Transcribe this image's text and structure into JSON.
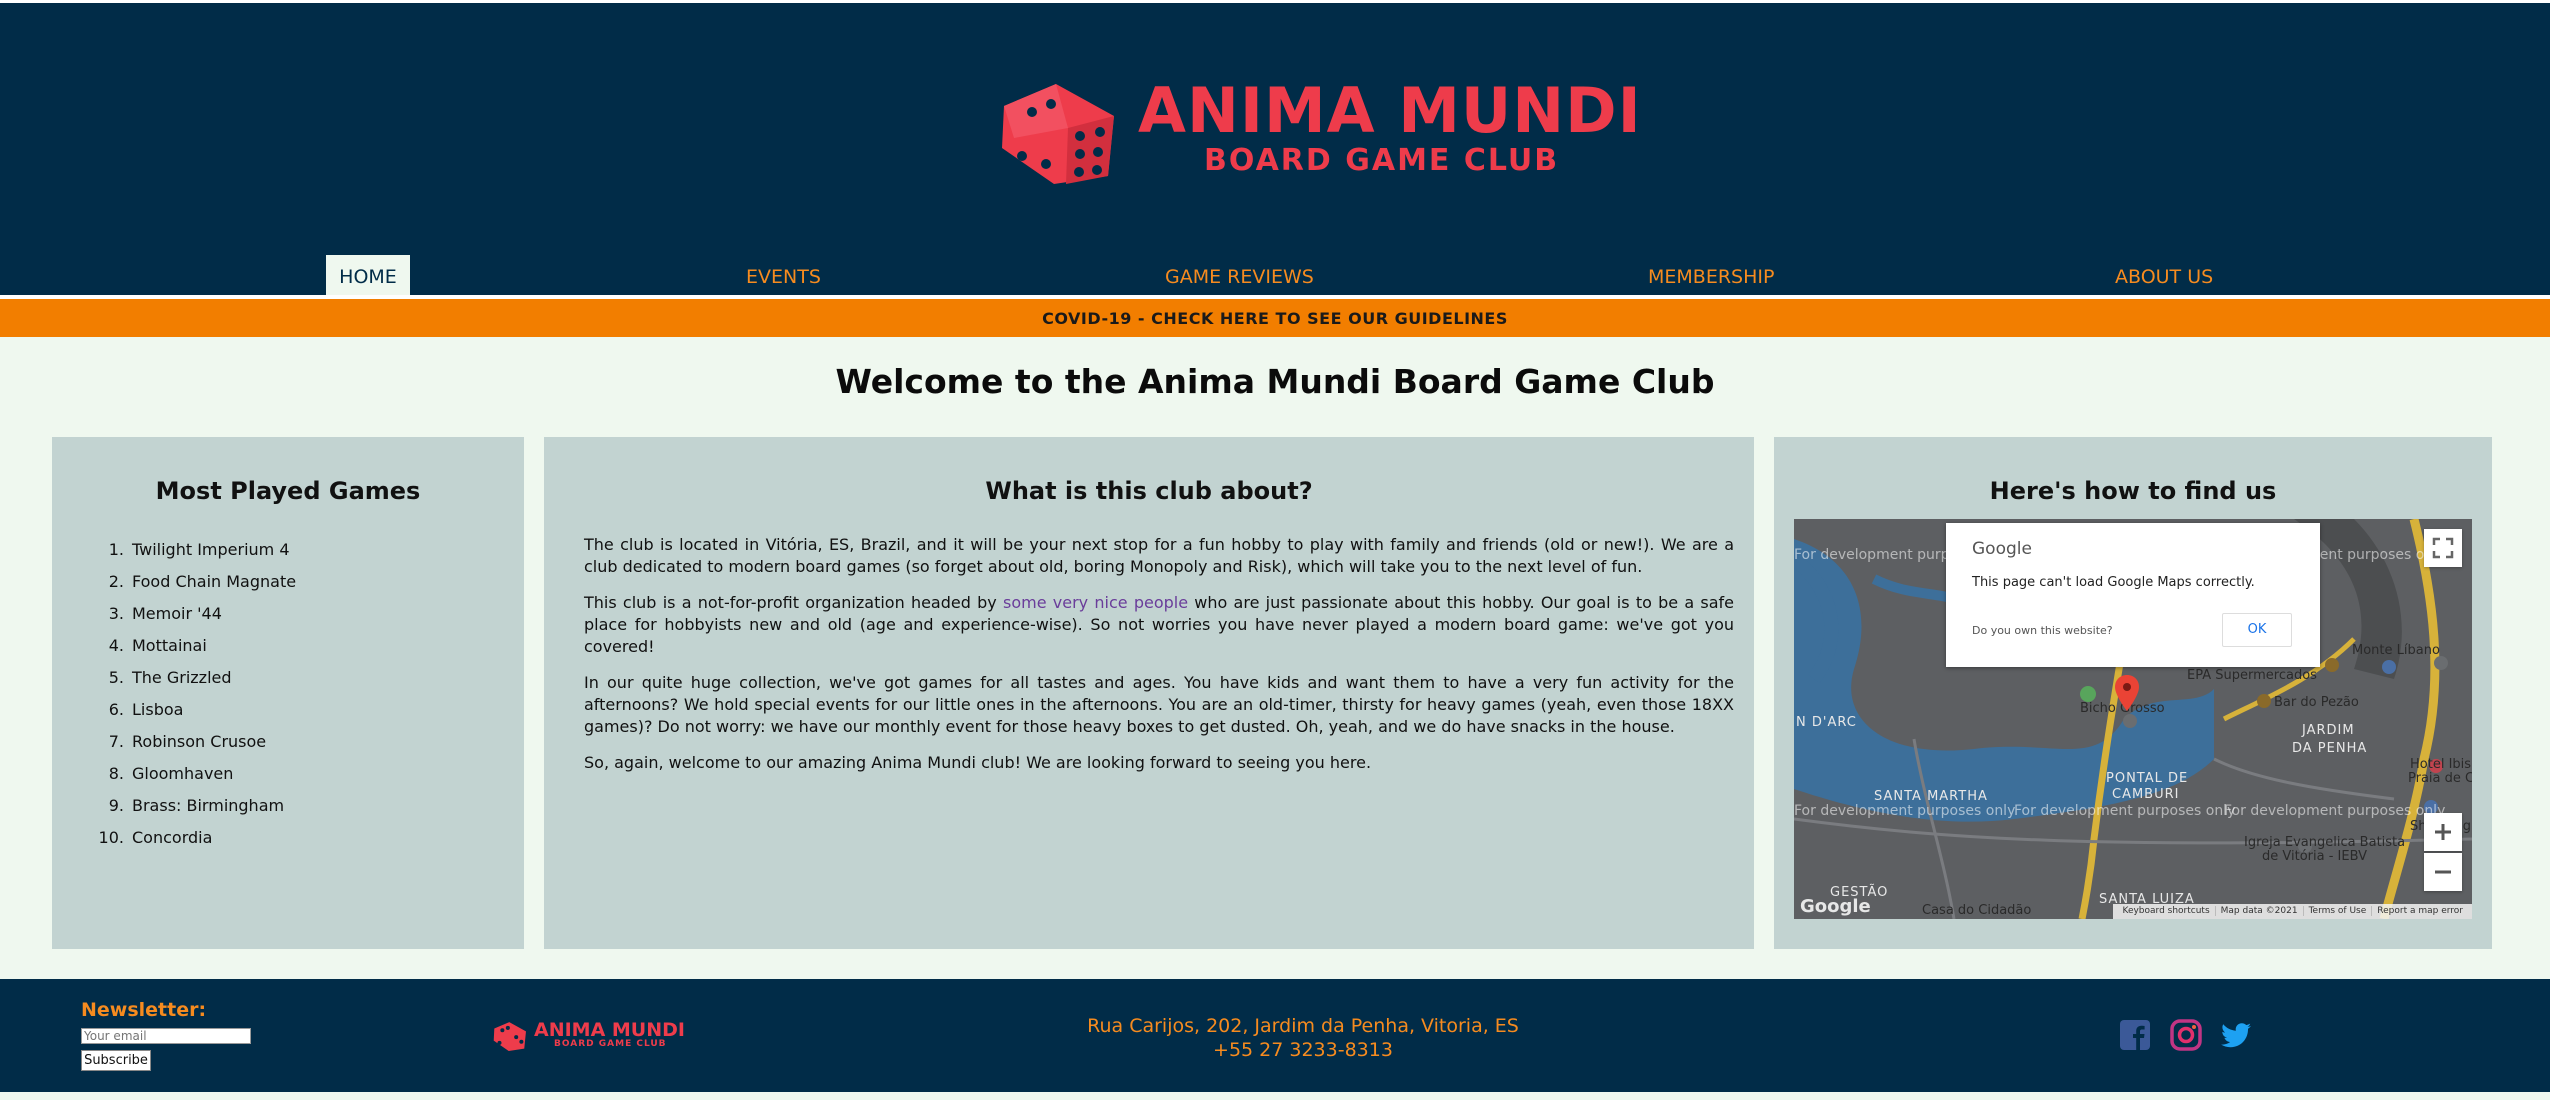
{
  "brand": {
    "title": "ANIMA MUNDI",
    "subtitle": "BOARD GAME CLUB",
    "colors": {
      "header_bg": "#012c48",
      "accent_red": "#ee3c4b",
      "accent_orange": "#f68b1f",
      "banner": "#f27e00",
      "panel": "#c2d3d1",
      "page_bg": "#eff8ef"
    }
  },
  "nav": {
    "home": "HOME",
    "events": "EVENTS",
    "reviews": "GAME REVIEWS",
    "membership": "MEMBERSHIP",
    "about": "ABOUT US"
  },
  "banner": "COVID-19 - CHECK HERE TO SEE OUR GUIDELINES",
  "welcome": "Welcome to the Anima Mundi Board Game Club",
  "games": {
    "heading": "Most Played Games",
    "items": [
      {
        "num": "1.",
        "name": "Twilight Imperium 4"
      },
      {
        "num": "2.",
        "name": "Food Chain Magnate"
      },
      {
        "num": "3.",
        "name": "Memoir '44"
      },
      {
        "num": "4.",
        "name": "Mottainai"
      },
      {
        "num": "5.",
        "name": "The Grizzled"
      },
      {
        "num": "6.",
        "name": "Lisboa"
      },
      {
        "num": "7.",
        "name": "Robinson Crusoe"
      },
      {
        "num": "8.",
        "name": "Gloomhaven"
      },
      {
        "num": "9.",
        "name": "Brass: Birmingham"
      },
      {
        "num": "10.",
        "name": "Concordia"
      }
    ]
  },
  "about": {
    "heading": "What is this club about?",
    "p1": "The club is located in Vitória, ES, Brazil, and it will be your next stop for a fun hobby to play with family and friends (old or new!). We are a club dedicated to modern board games (so forget about old, boring Monopoly and Risk), which will take you to the next level of fun.",
    "p2_before": "This club is a not-for-profit organization headed by ",
    "p2_link": "some very nice people",
    "p2_after": " who are just passionate about this hobby. Our goal is to be a safe place for hobbyists new and old (age and experience-wise). So not worries you have never played a modern board game: we've got you covered!",
    "p3": "In our quite huge collection, we've got games for all tastes and ages. You have kids and want them to have a very fun activity for the afternoons? We hold special events for our little ones in the afternoons. You are an old-timer, thirsty for heavy games (yeah, even those 18XX games)? Do not worry: we have our monthly event for those heavy boxes to get dusted. Oh, yeah, and we do have snacks in the house.",
    "p4": "So, again, welcome to our amazing Anima Mundi club! We are looking forward to seeing you here."
  },
  "find": {
    "heading": "Here's how to find us",
    "dialog": {
      "brand": "Google",
      "message": "This page can't load Google Maps correctly.",
      "question": "Do you own this website?",
      "ok": "OK"
    },
    "dev_text": "For development purposes only",
    "labels": {
      "jardim": "JARDIM",
      "da_penha": "DA PENHA",
      "pontal": "PONTAL DE",
      "camburi": "CAMBURI",
      "santa_martha": "SANTA MARTHA",
      "santa_luiza": "SANTA LUIZA",
      "n_darc": "N D'ARC",
      "gestao": "GESTÃO",
      "epa": "EPA Supermercados",
      "bar": "Bar do Pezão",
      "igreja": "Igreja Evangelica Batista",
      "igreja2": "de Vitória - IEBV",
      "casa": "Casa do Cidadão",
      "bicho": "Bicho Grosso",
      "monte": "Monte Líbano",
      "hotel": "Hotel Ibis",
      "praia": "Praia de C",
      "shopping": "Shopping"
    },
    "footer": {
      "shortcuts": "Keyboard shortcuts",
      "mapdata": "Map data ©2021",
      "terms": "Terms of Use",
      "report": "Report a map error"
    },
    "google_logo": "Google"
  },
  "footer": {
    "newsletter_label": "Newsletter:",
    "email_placeholder": "Your email",
    "subscribe": "Subscribe",
    "logo_title": "ANIMA MUNDI",
    "logo_sub": "BOARD GAME CLUB",
    "address": "Rua Carijos, 202, Jardim da Penha, Vitoria, ES",
    "phone": "+55 27 3233-8313",
    "social_icons": [
      "facebook-icon",
      "instagram-icon",
      "twitter-icon"
    ]
  }
}
